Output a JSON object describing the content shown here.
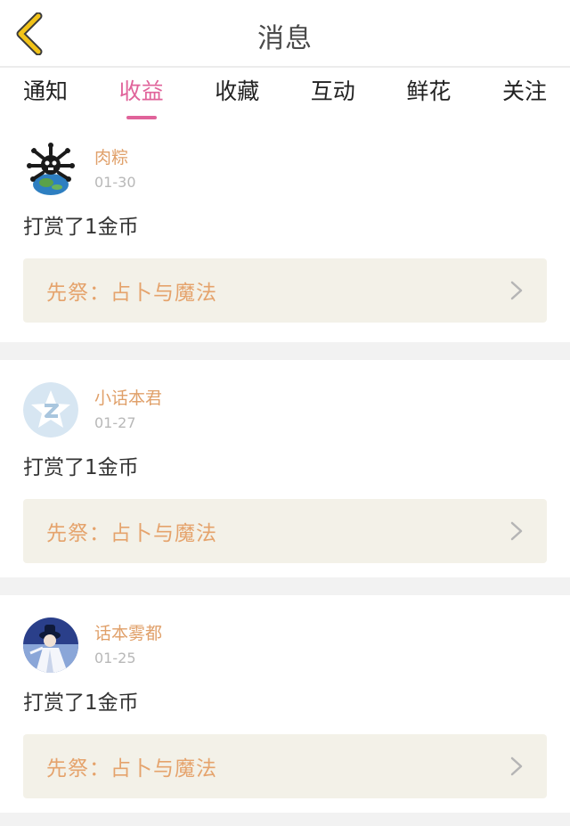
{
  "header": {
    "title": "消息",
    "back_icon": "chevron-left-icon",
    "back_color": "#f2c318"
  },
  "tabs": [
    {
      "label": "通知",
      "active": false
    },
    {
      "label": "收益",
      "active": true
    },
    {
      "label": "收藏",
      "active": false
    },
    {
      "label": "互动",
      "active": false
    },
    {
      "label": "鲜花",
      "active": false
    },
    {
      "label": "关注",
      "active": false
    }
  ],
  "colors": {
    "accent": "#e0639a",
    "username": "#e0a06a",
    "book_link_bg": "#f3f1e8",
    "book_link_text": "#e5a36c"
  },
  "messages": [
    {
      "username": "肉粽",
      "date": "01-30",
      "text": "打赏了1金币",
      "book": "先祭：占卜与魔法",
      "avatar_icon": "skull-earth-avatar"
    },
    {
      "username": "小话本君",
      "date": "01-27",
      "text": "打赏了1金币",
      "book": "先祭：占卜与魔法",
      "avatar_icon": "default-star-avatar"
    },
    {
      "username": "话本雾都",
      "date": "01-25",
      "text": "打赏了1金币",
      "book": "先祭：占卜与魔法",
      "avatar_icon": "character-photo-avatar"
    }
  ]
}
